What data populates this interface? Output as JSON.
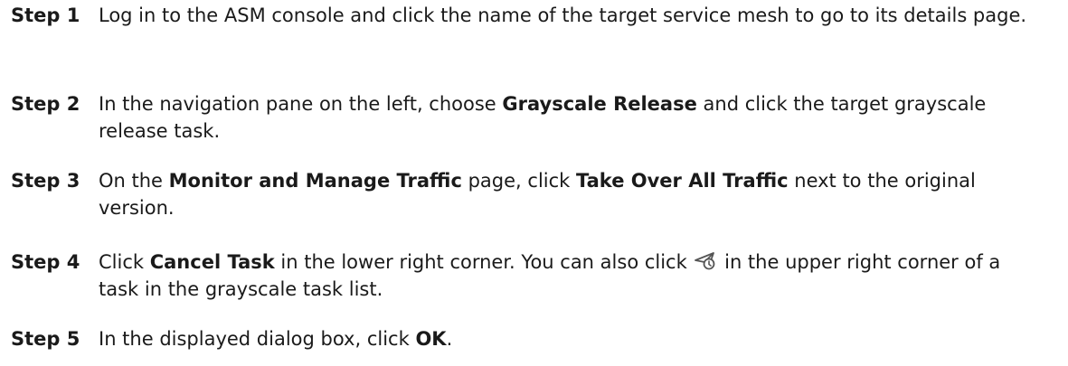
{
  "steps": [
    {
      "label": "Step 1",
      "text": "Log in to the ASM console and click the name of the target service mesh to go to its details page."
    },
    {
      "label": "Step 2",
      "pre": "In the navigation pane on the left, choose ",
      "bold1": "Grayscale Release",
      "post": " and click the target grayscale release task."
    },
    {
      "label": "Step 3",
      "pre": "On the ",
      "bold1": "Monitor and Manage Traffic",
      "mid": " page, click ",
      "bold2": "Take Over All Traffic",
      "post": " next to the original version."
    },
    {
      "label": "Step 4",
      "pre": "Click ",
      "bold1": "Cancel Task",
      "mid": " in the lower right corner. You can also click ",
      "icon": "cancel-task-icon",
      "post": " in the upper right corner of a task in the grayscale task list."
    },
    {
      "label": "Step 5",
      "pre": "In the displayed dialog box, click ",
      "bold1": "OK",
      "post": "."
    }
  ],
  "colors": {
    "text": "#1a1a1a",
    "icon_stroke": "#555555"
  }
}
